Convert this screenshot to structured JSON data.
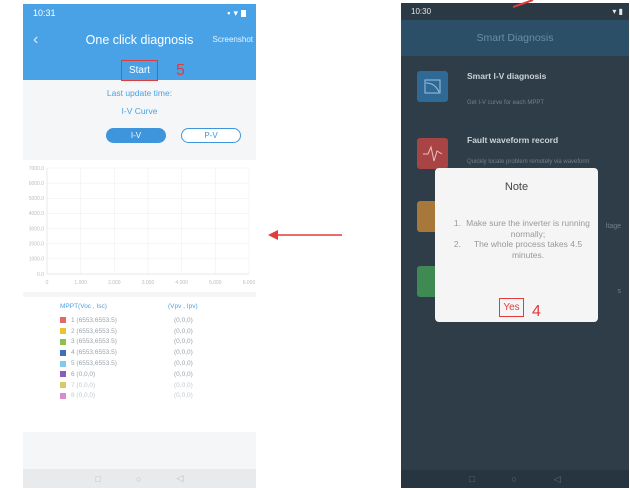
{
  "left_phone": {
    "status": {
      "time": "10:31"
    },
    "header": {
      "back_glyph": "‹",
      "title": "One click diagnosis",
      "screenshot": "Screenshot"
    },
    "start_label": "Start",
    "callout": "5",
    "last_update": "Last update time:",
    "curve_label": "I-V Curve",
    "toggles": [
      "I-V",
      "P-V"
    ],
    "chart_data": {
      "type": "line",
      "title": "",
      "xlabel": "",
      "ylabel": "",
      "y_ticks": [
        "7000.0",
        "6000.0",
        "5000.0",
        "4000.0",
        "3000.0",
        "2000.0",
        "1000.0",
        "0.0"
      ],
      "x_ticks": [
        "0",
        "1.000",
        "2.000",
        "3.000",
        "4.000",
        "5.000",
        "6.000"
      ],
      "ylim": [
        0,
        7000
      ],
      "xlim": [
        0,
        6000
      ],
      "grid": true,
      "series": []
    },
    "legend": {
      "col1": "MPPT(Voc , Isc)",
      "col2": "(Vpv , Ipv)",
      "rows": [
        {
          "color": "#e06a6a",
          "mppt": "1   (6553,6553.5)",
          "vi": "(0,0,0)",
          "dim": false
        },
        {
          "color": "#e8c431",
          "mppt": "2   (6553,6553.5)",
          "vi": "(0,0,0)",
          "dim": false
        },
        {
          "color": "#8cc152",
          "mppt": "3   (6553,6553.5)",
          "vi": "(0,0,0)",
          "dim": false
        },
        {
          "color": "#3f6fb5",
          "mppt": "4   (6553,6553.5)",
          "vi": "(0,0,0)",
          "dim": false
        },
        {
          "color": "#7fcbe8",
          "mppt": "5   (6553,6553.5)",
          "vi": "(0,0,0)",
          "dim": false
        },
        {
          "color": "#8a5fb8",
          "mppt": "6   (0,0,0)",
          "vi": "(0,0,0)",
          "dim": false
        },
        {
          "color": "#d8c96a",
          "mppt": "7   (0,0,0)",
          "vi": "(0,0,0)",
          "dim": true
        },
        {
          "color": "#d98cc9",
          "mppt": "8   (0,0,0)",
          "vi": "(0,0,0)",
          "dim": true
        }
      ]
    },
    "nav": [
      "□",
      "○",
      "◁"
    ]
  },
  "right_phone": {
    "status": {
      "time": "10:30"
    },
    "header_title": "Smart Diagnosis",
    "items": [
      {
        "title": "Smart I-V diagnosis",
        "desc": "Get I-V curve for each MPPT",
        "icon_color": "#2f6a96",
        "icon": "iv-curve-icon"
      },
      {
        "title": "Fault waveform record",
        "desc": "Quickly locate problem remotely via waveform",
        "icon_color": "#a84444",
        "icon": "waveform-icon"
      },
      {
        "title": "",
        "desc": "",
        "side": "ltage",
        "icon_color": "#a8773a",
        "icon": "voltage-icon"
      },
      {
        "title": "",
        "desc": "",
        "side": "s",
        "icon_color": "#3f8a52",
        "icon": "check-icon"
      }
    ],
    "dialog": {
      "title": "Note",
      "items": [
        {
          "num": "1.",
          "text": "Make sure the inverter is running normally;"
        },
        {
          "num": "2.",
          "text": "The whole process takes 4.5 minutes."
        }
      ],
      "yes": "Yes",
      "callout": "4"
    },
    "nav": [
      "□",
      "○",
      "◁"
    ]
  },
  "colors": {
    "accent": "#4aa2e6",
    "callout_red": "#e23b3b",
    "dark_bg": "#2e3d47"
  }
}
